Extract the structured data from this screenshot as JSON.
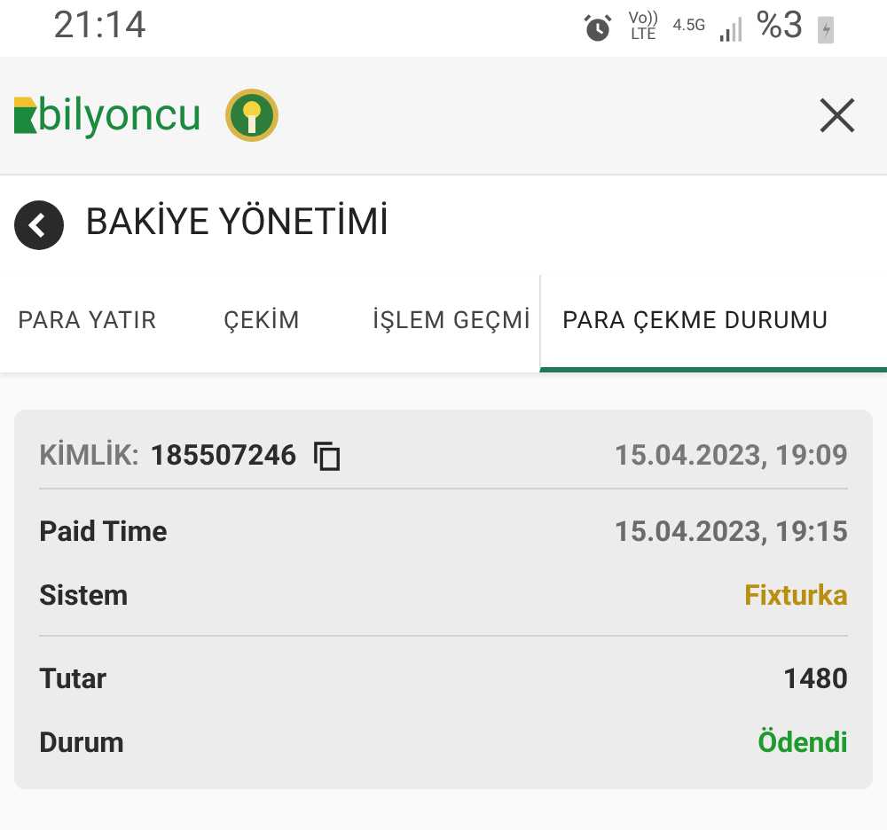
{
  "status_bar": {
    "time": "21:14",
    "volte": "Vo))",
    "lte": "LTE",
    "network": "4.5G",
    "battery": "%3"
  },
  "header": {
    "brand": "bilyoncu"
  },
  "page": {
    "title": "BAKİYE YÖNETİMİ"
  },
  "tabs": [
    {
      "label": "PARA YATIR",
      "selected": false
    },
    {
      "label": "ÇEKİM",
      "selected": false
    },
    {
      "label": "İŞLEM GEÇMİ",
      "selected": false
    },
    {
      "label": "PARA ÇEKME DURUMU",
      "selected": true
    }
  ],
  "card": {
    "id_label": "KİMLİK:",
    "id": "185507246",
    "date": "15.04.2023, 19:09",
    "sections": [
      [
        {
          "label": "Paid Time",
          "value": "15.04.2023, 19:15",
          "color": "#6b6b6b"
        },
        {
          "label": "Sistem",
          "value": "Fixturka",
          "color": "#b8900f"
        }
      ],
      [
        {
          "label": "Tutar",
          "value": "1480",
          "color": "#2b2b2b"
        },
        {
          "label": "Durum",
          "value": "Ödendi",
          "color": "#1e9a2e"
        }
      ]
    ]
  }
}
